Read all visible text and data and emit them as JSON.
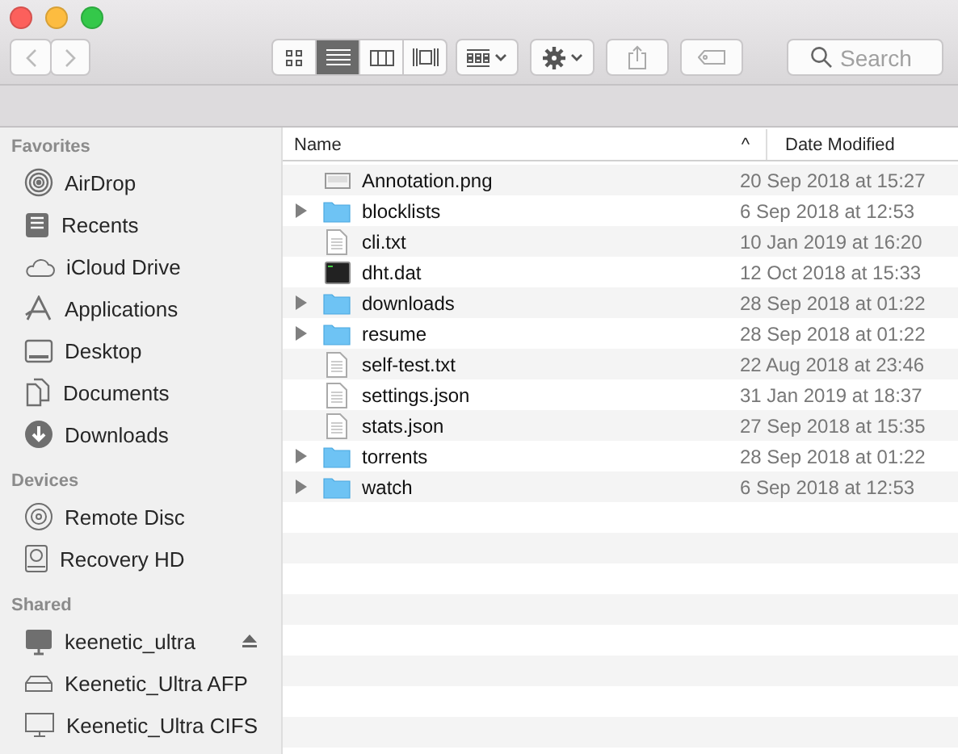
{
  "toolbar": {
    "view_modes": [
      {
        "kind": "icons",
        "selected": false
      },
      {
        "kind": "list",
        "selected": true
      },
      {
        "kind": "columns",
        "selected": false
      },
      {
        "kind": "gallery",
        "selected": false
      }
    ],
    "search": {
      "placeholder": "Search"
    }
  },
  "sidebar": {
    "sections": [
      {
        "title": "Favorites",
        "items": [
          {
            "label": "AirDrop",
            "kind": "airdrop",
            "ejectable": false
          },
          {
            "label": "Recents",
            "kind": "recents",
            "ejectable": false
          },
          {
            "label": "iCloud Drive",
            "kind": "cloud",
            "ejectable": false
          },
          {
            "label": "Applications",
            "kind": "apps",
            "ejectable": false
          },
          {
            "label": "Desktop",
            "kind": "desktop",
            "ejectable": false
          },
          {
            "label": "Documents",
            "kind": "documents",
            "ejectable": false
          },
          {
            "label": "Downloads",
            "kind": "downloads",
            "ejectable": false
          }
        ]
      },
      {
        "title": "Devices",
        "items": [
          {
            "label": "Remote Disc",
            "kind": "disc",
            "ejectable": false
          },
          {
            "label": "Recovery HD",
            "kind": "drive",
            "ejectable": false
          }
        ]
      },
      {
        "title": "Shared",
        "items": [
          {
            "label": "keenetic_ultra",
            "kind": "computer",
            "ejectable": true
          },
          {
            "label": "Keenetic_Ultra AFP",
            "kind": "server",
            "ejectable": false
          },
          {
            "label": "Keenetic_Ultra CIFS",
            "kind": "display",
            "ejectable": false
          }
        ]
      }
    ]
  },
  "file_list": {
    "columns": [
      {
        "label": "Name",
        "sort_indicator": "^"
      },
      {
        "label": "Date Modified"
      }
    ],
    "rows": [
      {
        "name": "Annotation.png",
        "kind": "image",
        "date": "20 Sep 2018 at 15:27"
      },
      {
        "name": "blocklists",
        "kind": "folder",
        "date": "6 Sep 2018 at 12:53"
      },
      {
        "name": "cli.txt",
        "kind": "text",
        "date": "10 Jan 2019 at 16:20"
      },
      {
        "name": "dht.dat",
        "kind": "exec",
        "date": "12 Oct 2018 at 15:33"
      },
      {
        "name": "downloads",
        "kind": "folder",
        "date": "28 Sep 2018 at 01:22"
      },
      {
        "name": "resume",
        "kind": "folder",
        "date": "28 Sep 2018 at 01:22"
      },
      {
        "name": "self-test.txt",
        "kind": "text",
        "date": "22 Aug 2018 at 23:46"
      },
      {
        "name": "settings.json",
        "kind": "text",
        "date": "31 Jan 2019 at 18:37"
      },
      {
        "name": "stats.json",
        "kind": "text",
        "date": "27 Sep 2018 at 15:35"
      },
      {
        "name": "torrents",
        "kind": "folder",
        "date": "28 Sep 2018 at 01:22"
      },
      {
        "name": "watch",
        "kind": "folder",
        "date": "6 Sep 2018 at 12:53"
      }
    ]
  }
}
